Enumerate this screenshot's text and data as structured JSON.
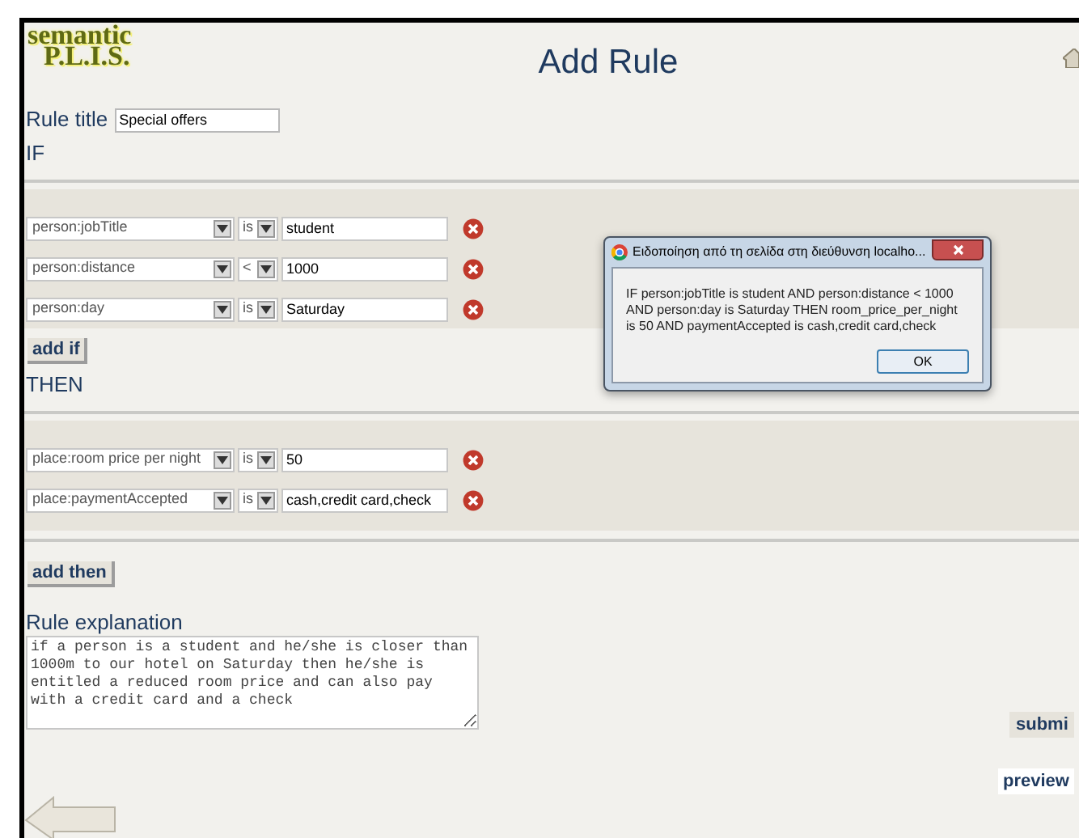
{
  "logo": {
    "line_1": "semantic",
    "line_2": "P.L.I.S."
  },
  "title": "Add Rule",
  "rule_title": {
    "label": "Rule title",
    "value": "Special offers"
  },
  "if_section": {
    "heading": "IF",
    "conditions": [
      {
        "property": "person:jobTitle",
        "operator": "is",
        "value": "student"
      },
      {
        "property": "person:distance",
        "operator": "<",
        "value": "1000"
      },
      {
        "property": "person:day",
        "operator": "is",
        "value": "Saturday"
      }
    ],
    "add_button": "add if"
  },
  "then_section": {
    "heading": "THEN",
    "conditions": [
      {
        "property": "place:room price per night",
        "operator": "is",
        "value": "50"
      },
      {
        "property": "place:paymentAccepted",
        "operator": "is",
        "value": "cash,credit card,check"
      }
    ],
    "add_button": "add then"
  },
  "explanation": {
    "label": "Rule explanation",
    "value": "if a person is a student and he/she is closer than 1000m to our hotel on Saturday then he/she is entitled a reduced room price and can also pay with a credit card and a check"
  },
  "submit_button": "submi",
  "preview_button": "preview",
  "dialog": {
    "title": "Ειδοποίηση από τη σελίδα στη διεύθυνση localho...",
    "message": "IF person:jobTitle is student AND person:distance < 1000 AND person:day is Saturday THEN room_price_per_night is 50 AND paymentAccepted is cash,credit card,check",
    "ok_button": "OK"
  }
}
